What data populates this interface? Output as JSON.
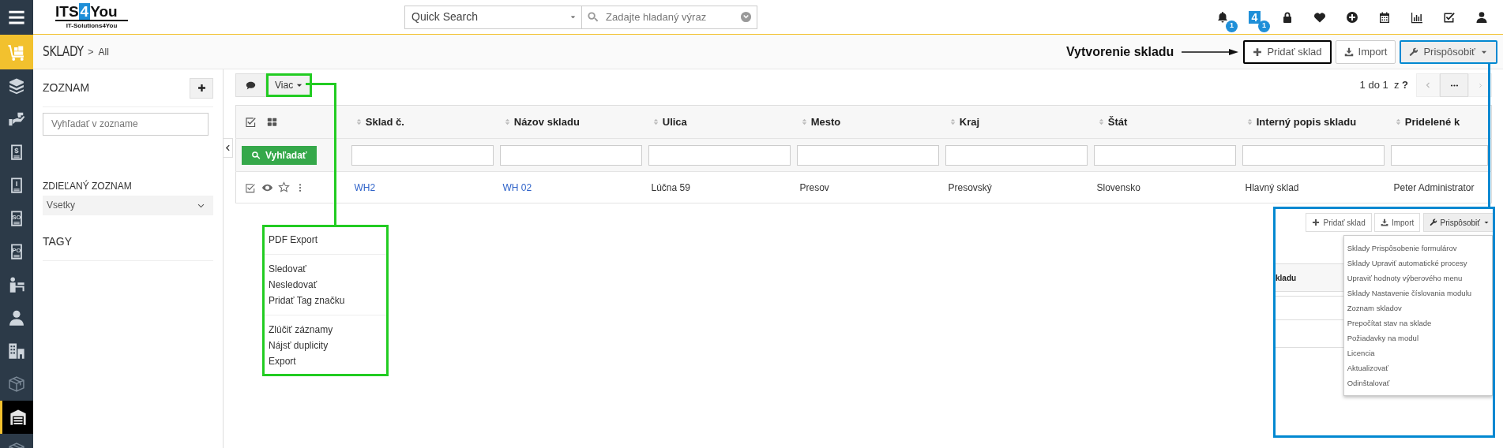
{
  "rail": {
    "items": [
      {
        "kind": "cube",
        "selected": false
      },
      {
        "kind": "hand",
        "selected": false
      },
      {
        "kind": "doc",
        "label": "$",
        "selected": false
      },
      {
        "kind": "doc",
        "label": "I",
        "selected": false
      },
      {
        "kind": "doc",
        "label": "SO",
        "selected": false
      },
      {
        "kind": "doc",
        "label": "PO",
        "selected": false
      },
      {
        "kind": "desk",
        "selected": false
      },
      {
        "kind": "person",
        "selected": false
      },
      {
        "kind": "buildings",
        "selected": false
      },
      {
        "kind": "package",
        "selected": false
      },
      {
        "kind": "warehouse",
        "selected": true
      },
      {
        "kind": "package",
        "selected": false
      }
    ]
  },
  "header": {
    "logo": {
      "parts": [
        "ITS",
        "4",
        "You"
      ],
      "tagline": "IT-Solutions4You"
    },
    "quick_search": {
      "value": "Quick Search"
    },
    "search": {
      "placeholder": "Zadajte hladaný výraz"
    },
    "icons": [
      {
        "kind": "bell",
        "badge": "1"
      },
      {
        "kind": "app",
        "label": "4",
        "badge": "1"
      },
      {
        "kind": "lock"
      },
      {
        "kind": "heart"
      },
      {
        "kind": "plus-circle"
      },
      {
        "kind": "calendar"
      },
      {
        "kind": "chart"
      },
      {
        "kind": "task"
      },
      {
        "kind": "user"
      }
    ]
  },
  "breadcrumb": {
    "module": "SKLADY",
    "separator": ">",
    "view": "All"
  },
  "annotation": {
    "label": "Vytvorenie skladu"
  },
  "actions": [
    {
      "label": "Pridať sklad",
      "color": "#000000"
    },
    {
      "label": "Import"
    },
    {
      "label": "Prispôsobiť",
      "color": "#0288d1"
    }
  ],
  "sidebar": {
    "title": "ZOZNAM",
    "search": {
      "placeholder": "Vyhľadať v zozname"
    },
    "shared": {
      "title": "ZDIEĽANÝ ZOZNAM",
      "value": "Vsetky"
    },
    "tags": {
      "title": "TAGY"
    }
  },
  "toolbar": {
    "more": {
      "label": "Viac",
      "color": "#22cc22"
    },
    "pagination": "1 do 1  z **?**"
  },
  "table": {
    "columns": [
      "Sklad č.",
      "Názov skladu",
      "Ulica",
      "Mesto",
      "Kraj",
      "Štát",
      "Interný popis skladu",
      "Pridelené k"
    ],
    "search_button": "Vyhľadať",
    "rows": [
      {
        "cells": [
          {
            "text": "WH2",
            "link": true
          },
          {
            "text": "WH 02",
            "link": true
          },
          {
            "text": "Lúčna 59",
            "link": false
          },
          {
            "text": "Presov",
            "link": false
          },
          {
            "text": "Presovský",
            "link": false
          },
          {
            "text": "Slovensko",
            "link": false
          },
          {
            "text": "Hlavný sklad",
            "link": false
          },
          {
            "text": "Peter Administrator",
            "link": false
          }
        ]
      }
    ]
  },
  "more_menu": {
    "color": "#22cc22",
    "groups": [
      [
        "PDF Export"
      ],
      [
        "Sledovať",
        "Nesledovať",
        "Pridať Tag značku"
      ],
      [
        "Zlúčiť záznamy",
        "Nájsť duplicity",
        "Export"
      ]
    ]
  },
  "inset": {
    "color": "#0288d1",
    "buttons": [
      {
        "label": "Pridať sklad"
      },
      {
        "label": "Import"
      },
      {
        "label": "Prispôsobiť"
      }
    ],
    "column_fragment": "kladu",
    "menu": [
      "Sklady Prispôsobenie formulárov",
      "Sklady Upraviť automatické procesy",
      "Upraviť hodnoty výberového menu",
      "Sklady Nastavenie číslovania modulu",
      "Zoznam skladov",
      "Prepočítat stav na sklade",
      "Požiadavky na modul",
      "Licencia",
      "Aktualizovať",
      "Odinštalovať"
    ]
  }
}
